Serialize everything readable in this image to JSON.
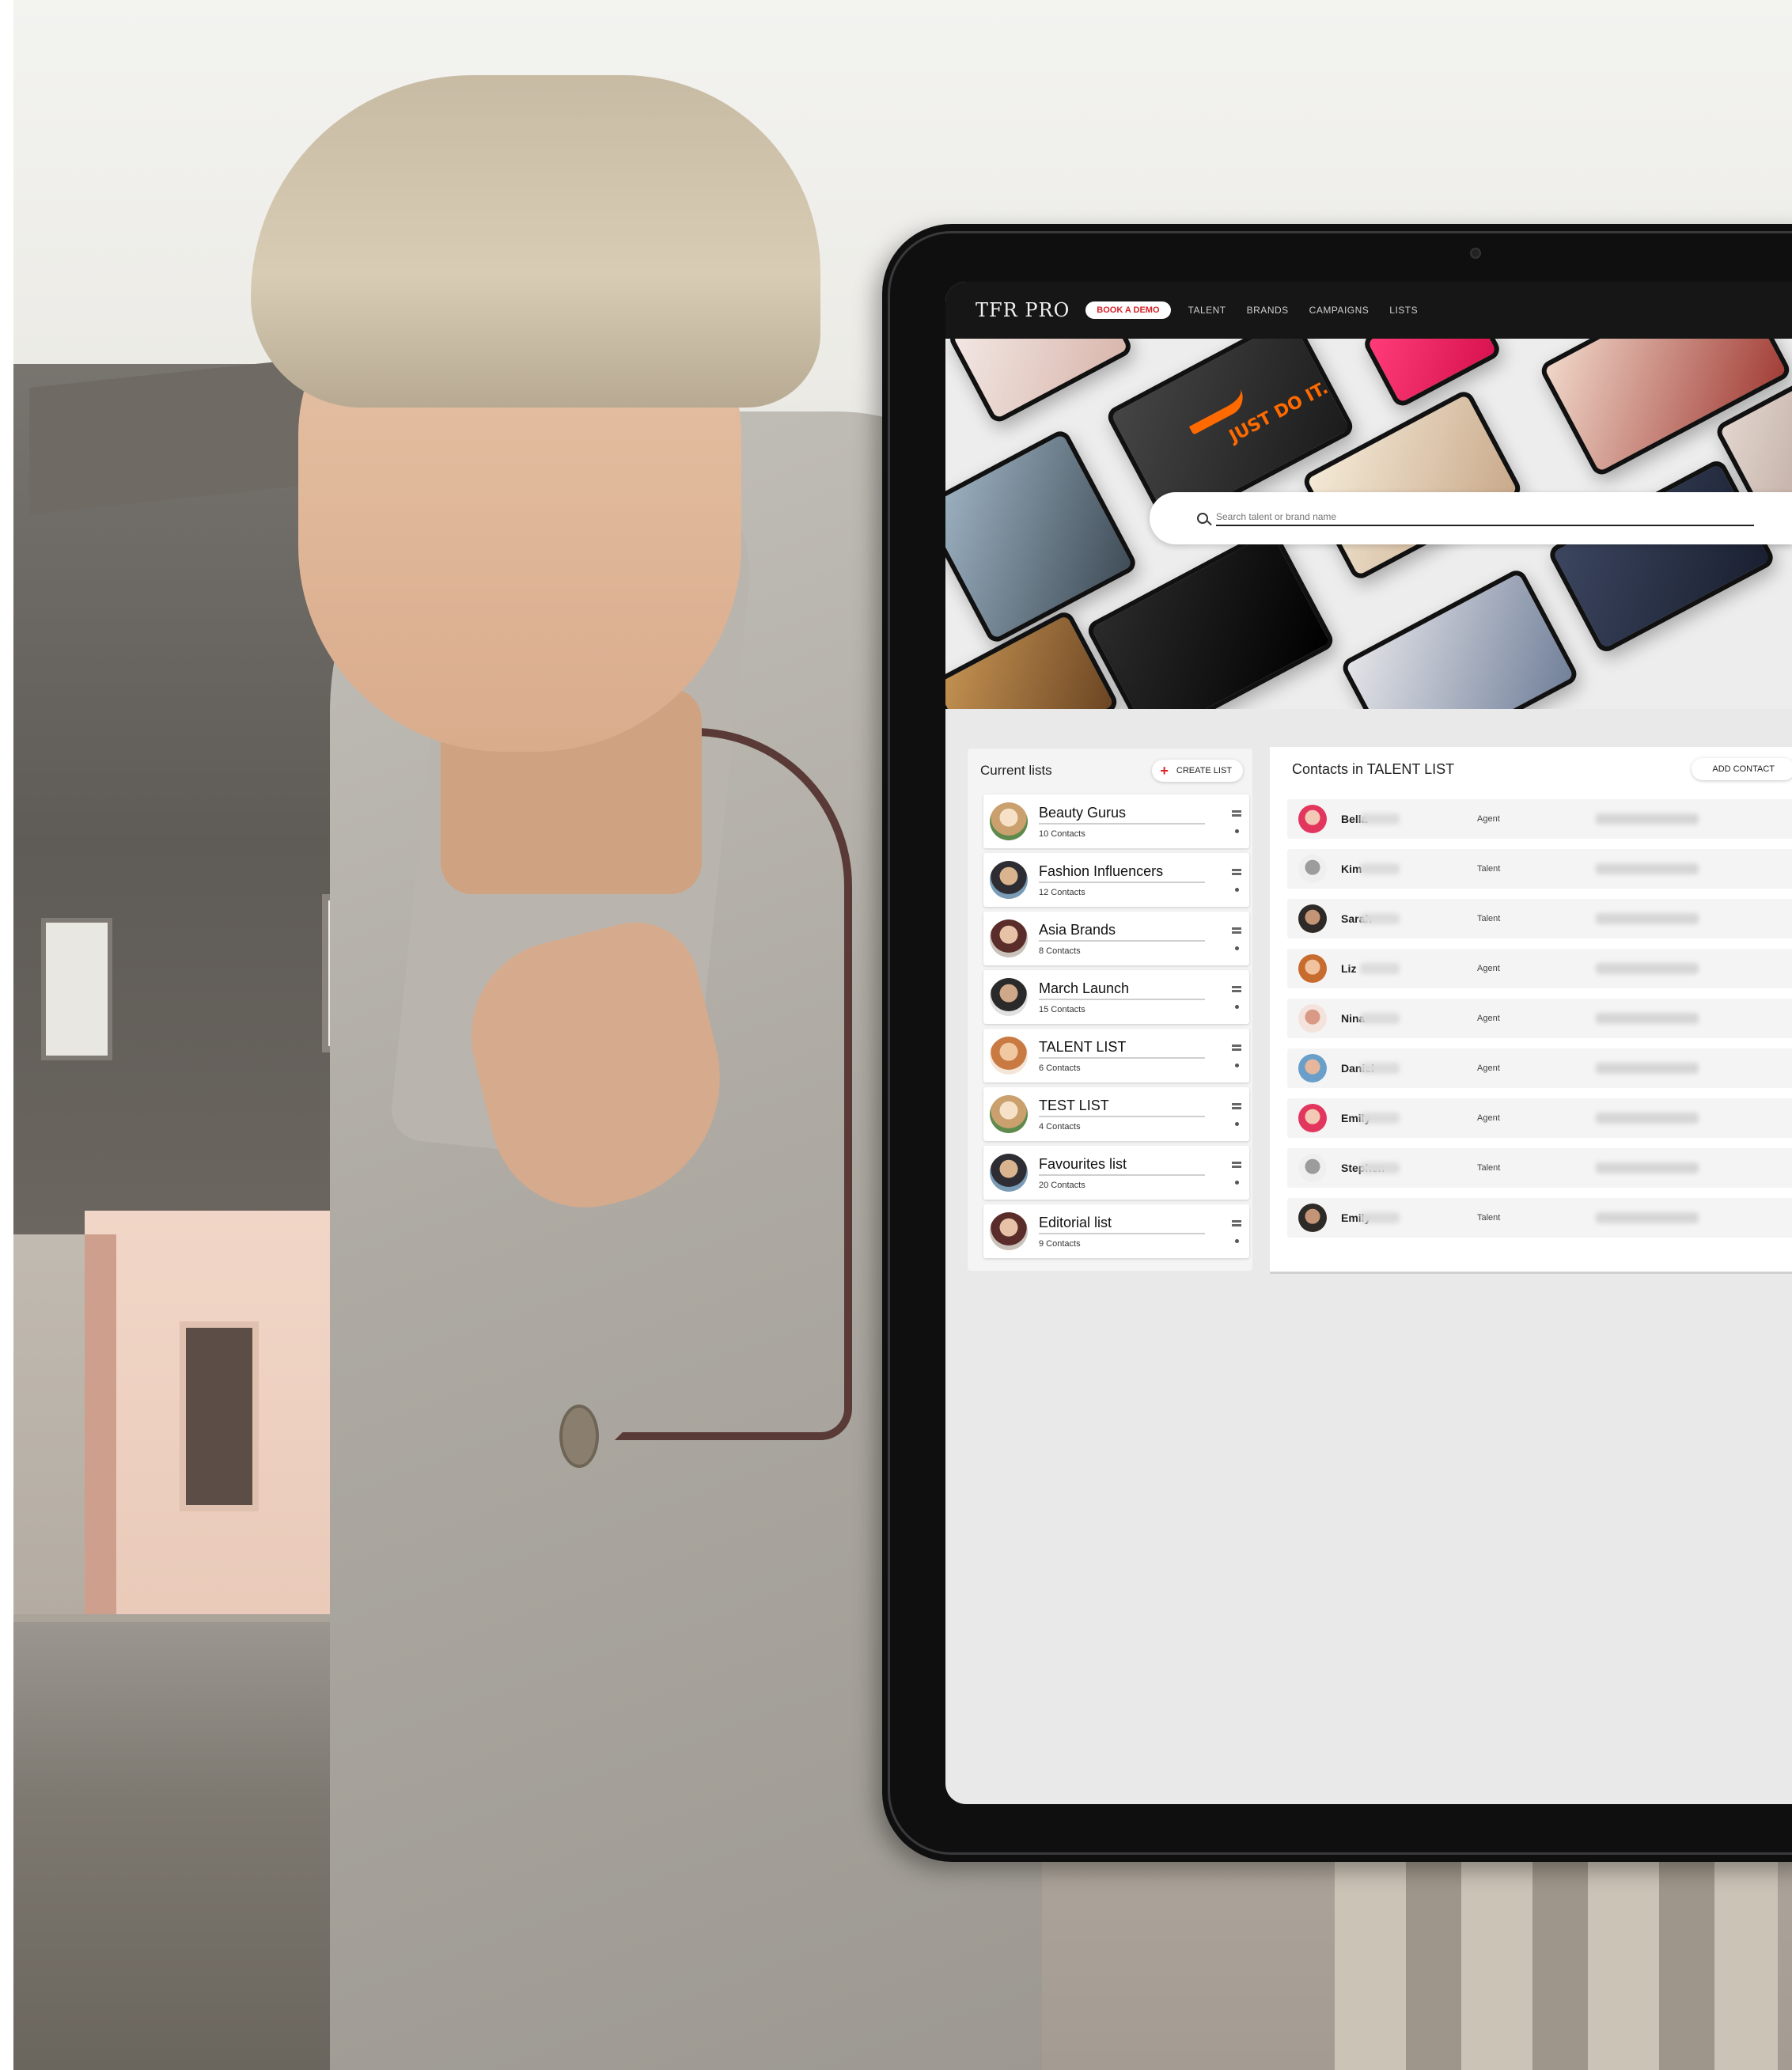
{
  "nav": {
    "logo": "TFR PRO",
    "pill": "BOOK A DEMO",
    "links": [
      "TALENT",
      "BRANDS",
      "CAMPAIGNS",
      "LISTS"
    ]
  },
  "search": {
    "placeholder": "Search talent or brand name"
  },
  "lists_panel": {
    "title": "Current lists",
    "create_label": "CREATE LIST",
    "items": [
      {
        "name": "Beauty Gurus",
        "count": "10 Contacts"
      },
      {
        "name": "Fashion Influencers",
        "count": "12 Contacts"
      },
      {
        "name": "Asia Brands",
        "count": "8 Contacts"
      },
      {
        "name": "March Launch",
        "count": "15 Contacts"
      },
      {
        "name": "TALENT LIST",
        "count": "6 Contacts"
      },
      {
        "name": "TEST LIST",
        "count": "4 Contacts"
      },
      {
        "name": "Favourites list",
        "count": "20 Contacts"
      },
      {
        "name": "Editorial list",
        "count": "9 Contacts"
      }
    ]
  },
  "contacts_panel": {
    "title": "Contacts in TALENT LIST",
    "add_label": "ADD CONTACT",
    "rows": [
      {
        "name": "Bella",
        "value": "Agent"
      },
      {
        "name": "Kim",
        "value": "Talent"
      },
      {
        "name": "Sarah",
        "value": "Talent"
      },
      {
        "name": "Liz",
        "value": "Agent"
      },
      {
        "name": "Nina",
        "value": "Agent"
      },
      {
        "name": "Daniel",
        "value": "Agent"
      },
      {
        "name": "Emily",
        "value": "Agent"
      },
      {
        "name": "Stephen",
        "value": "Talent"
      },
      {
        "name": "Emily",
        "value": "Talent"
      }
    ]
  },
  "colors": {
    "accent": "#e0242b",
    "nav_bg": "#161616",
    "panel_bg": "#f4f4f4",
    "screen_bg": "#e9e9e9"
  }
}
